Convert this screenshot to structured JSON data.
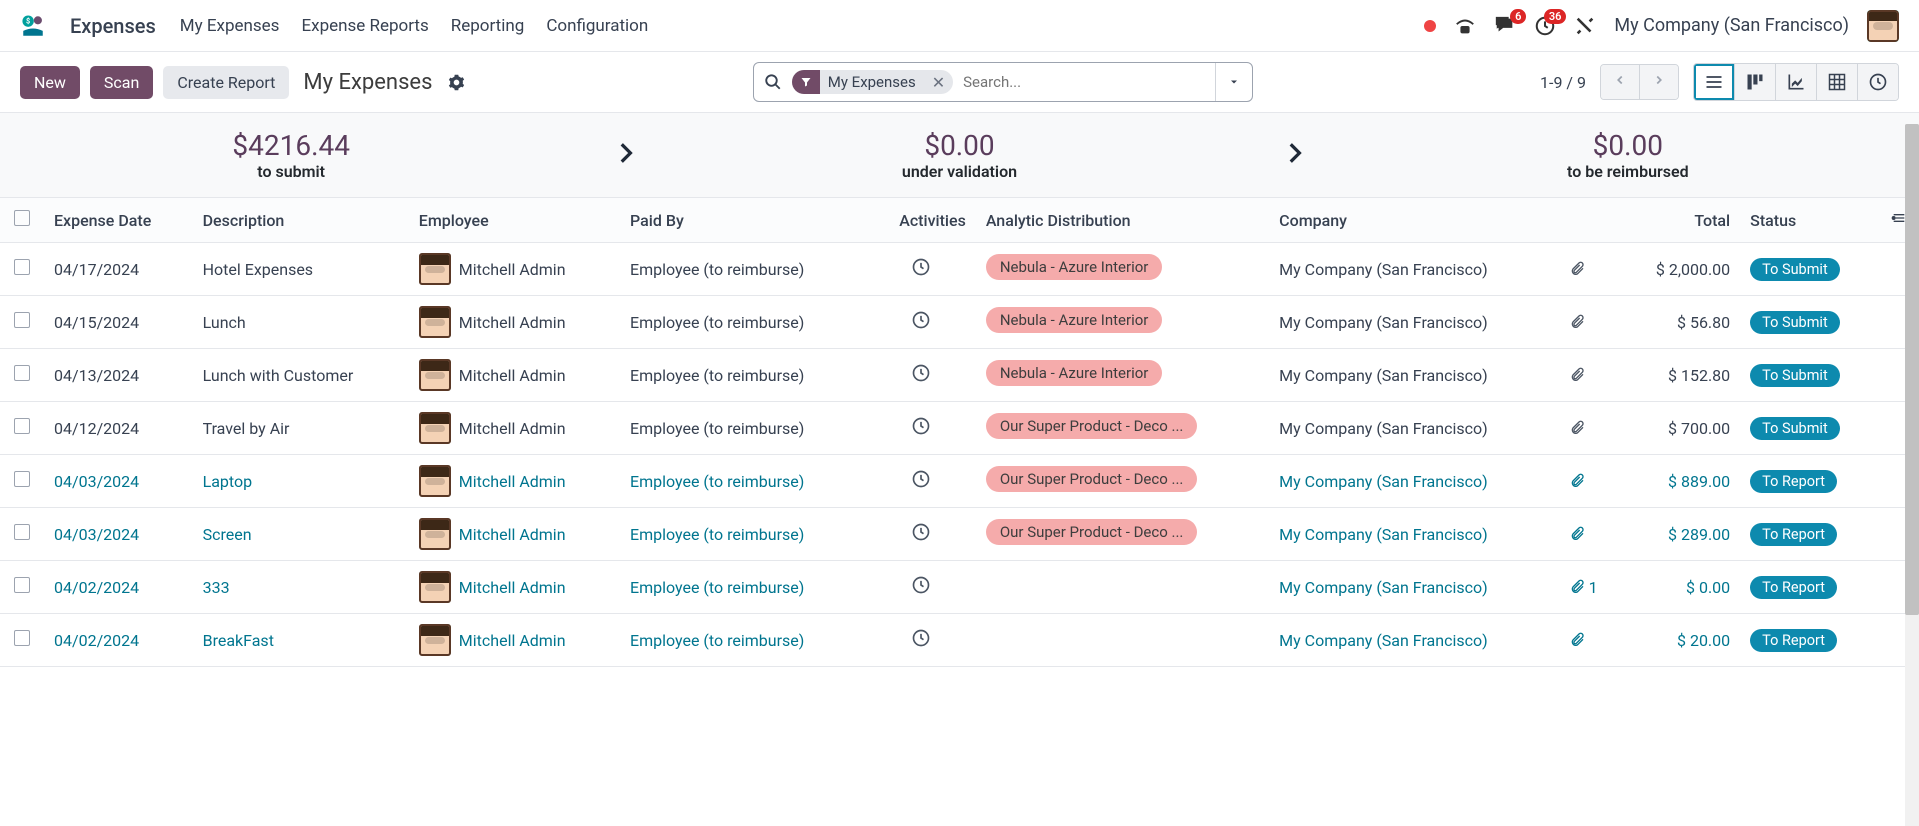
{
  "header": {
    "app_title": "Expenses",
    "nav": [
      "My Expenses",
      "Expense Reports",
      "Reporting",
      "Configuration"
    ],
    "chat_badge": "6",
    "activity_badge": "36",
    "company": "My Company (San Francisco)"
  },
  "control": {
    "new_btn": "New",
    "scan_btn": "Scan",
    "create_report_btn": "Create Report",
    "breadcrumb": "My Expenses",
    "search_tag": "My Expenses",
    "search_placeholder": "Search...",
    "pager": "1-9 / 9"
  },
  "summary": {
    "submit_amount": "$4216.44",
    "submit_label": "to submit",
    "validation_amount": "$0.00",
    "validation_label": "under validation",
    "reimburse_amount": "$0.00",
    "reimburse_label": "to be reimbursed"
  },
  "columns": {
    "date": "Expense Date",
    "description": "Description",
    "employee": "Employee",
    "paid_by": "Paid By",
    "activities": "Activities",
    "analytic": "Analytic Distribution",
    "company": "Company",
    "total": "Total",
    "status": "Status"
  },
  "rows": [
    {
      "date": "04/17/2024",
      "desc": "Hotel Expenses",
      "emp": "Mitchell Admin",
      "paid": "Employee (to reimburse)",
      "analytic": "Nebula - Azure Interior",
      "company": "My Company (San Francisco)",
      "attach": "",
      "total": "$ 2,000.00",
      "status": "To Submit",
      "link": false
    },
    {
      "date": "04/15/2024",
      "desc": "Lunch",
      "emp": "Mitchell Admin",
      "paid": "Employee (to reimburse)",
      "analytic": "Nebula - Azure Interior",
      "company": "My Company (San Francisco)",
      "attach": "",
      "total": "$ 56.80",
      "status": "To Submit",
      "link": false
    },
    {
      "date": "04/13/2024",
      "desc": "Lunch with Customer",
      "emp": "Mitchell Admin",
      "paid": "Employee (to reimburse)",
      "analytic": "Nebula - Azure Interior",
      "company": "My Company (San Francisco)",
      "attach": "",
      "total": "$ 152.80",
      "status": "To Submit",
      "link": false
    },
    {
      "date": "04/12/2024",
      "desc": "Travel by Air",
      "emp": "Mitchell Admin",
      "paid": "Employee (to reimburse)",
      "analytic": "Our Super Product - Deco ...",
      "company": "My Company (San Francisco)",
      "attach": "",
      "total": "$ 700.00",
      "status": "To Submit",
      "link": false
    },
    {
      "date": "04/03/2024",
      "desc": "Laptop",
      "emp": "Mitchell Admin",
      "paid": "Employee (to reimburse)",
      "analytic": "Our Super Product - Deco ...",
      "company": "My Company (San Francisco)",
      "attach": "",
      "total": "$ 889.00",
      "status": "To Report",
      "link": true
    },
    {
      "date": "04/03/2024",
      "desc": "Screen",
      "emp": "Mitchell Admin",
      "paid": "Employee (to reimburse)",
      "analytic": "Our Super Product - Deco ...",
      "company": "My Company (San Francisco)",
      "attach": "",
      "total": "$ 289.00",
      "status": "To Report",
      "link": true
    },
    {
      "date": "04/02/2024",
      "desc": "333",
      "emp": "Mitchell Admin",
      "paid": "Employee (to reimburse)",
      "analytic": "",
      "company": "My Company (San Francisco)",
      "attach": "1",
      "total": "$ 0.00",
      "status": "To Report",
      "link": true
    },
    {
      "date": "04/02/2024",
      "desc": "BreakFast",
      "emp": "Mitchell Admin",
      "paid": "Employee (to reimburse)",
      "analytic": "",
      "company": "My Company (San Francisco)",
      "attach": "",
      "total": "$ 20.00",
      "status": "To Report",
      "link": true
    }
  ]
}
